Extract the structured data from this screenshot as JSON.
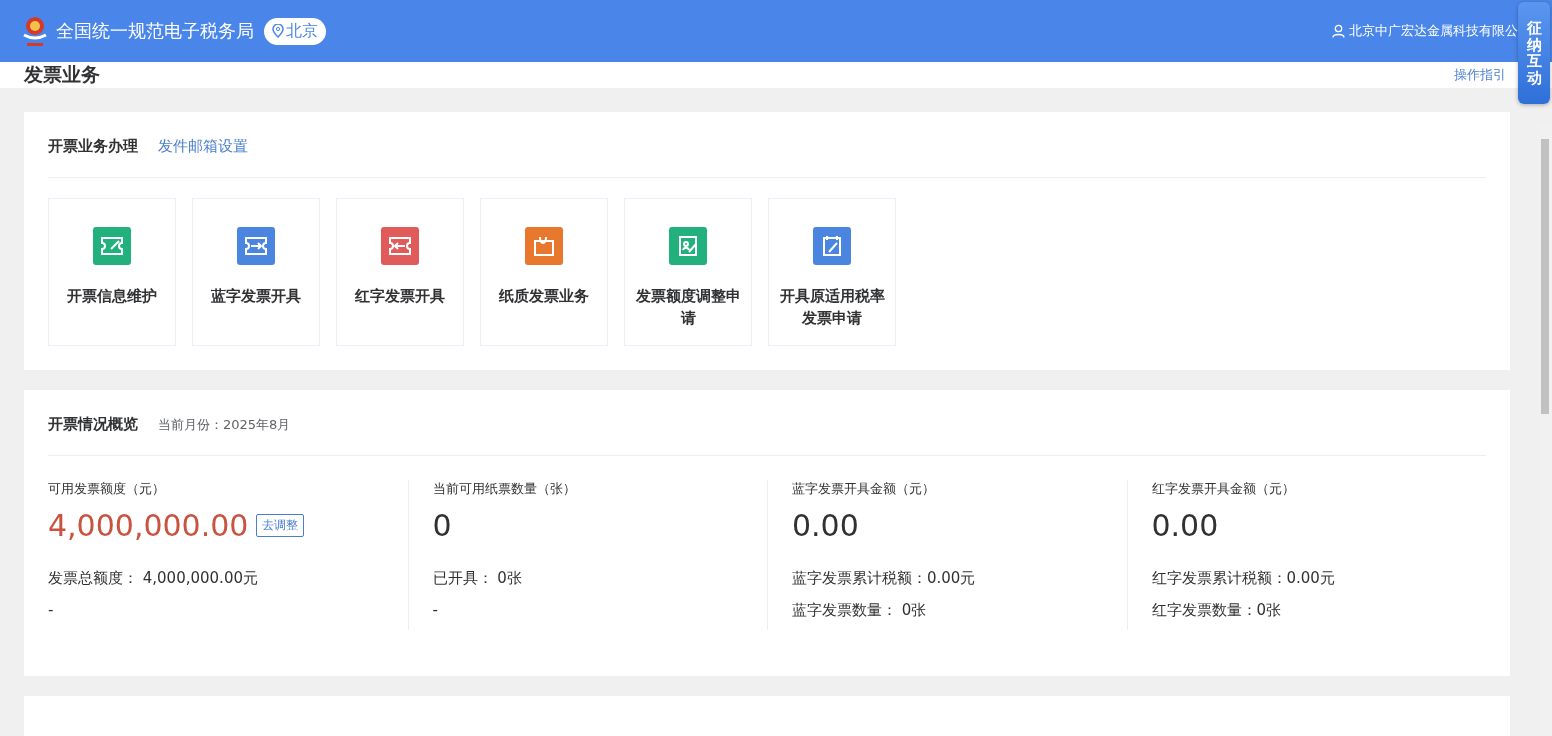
{
  "header": {
    "title": "全国统一规范电子税务局",
    "region": "北京",
    "user": "北京中广宏达金属科技有限公"
  },
  "float_button": {
    "label": "征纳互动"
  },
  "page": {
    "title": "发票业务",
    "guide_link": "操作指引"
  },
  "business": {
    "title": "开票业务办理",
    "link": "发件邮箱设置",
    "tiles": [
      {
        "label": "开票信息维护",
        "color": "#22b07d"
      },
      {
        "label": "蓝字发票开具",
        "color": "#4a86e0"
      },
      {
        "label": "红字发票开具",
        "color": "#e25b5b"
      },
      {
        "label": "纸质发票业务",
        "color": "#e8782e"
      },
      {
        "label": "发票额度调整申请",
        "color": "#22b07d"
      },
      {
        "label": "开具原适用税率发票申请",
        "color": "#4a86e0"
      }
    ]
  },
  "overview": {
    "title": "开票情况概览",
    "subtitle": "当前月份：2025年8月",
    "stats": [
      {
        "label": "可用发票额度（元）",
        "value": "4,000,000.00",
        "color": "#c9533f",
        "action": "去调整",
        "lines": [
          "发票总额度：  4,000,000.00元",
          "-"
        ]
      },
      {
        "label": "当前可用纸票数量（张）",
        "value": "0",
        "color": "#303133",
        "lines": [
          "已开具：  0张",
          "-"
        ]
      },
      {
        "label": "蓝字发票开具金额（元）",
        "value": "0.00",
        "color": "#303133",
        "lines": [
          "蓝字发票累计税额：0.00元",
          "蓝字发票数量：  0张"
        ]
      },
      {
        "label": "红字发票开具金额（元）",
        "value": "0.00",
        "color": "#303133",
        "lines": [
          "红字发票累计税额：0.00元",
          "红字发票数量：0张"
        ]
      }
    ]
  }
}
